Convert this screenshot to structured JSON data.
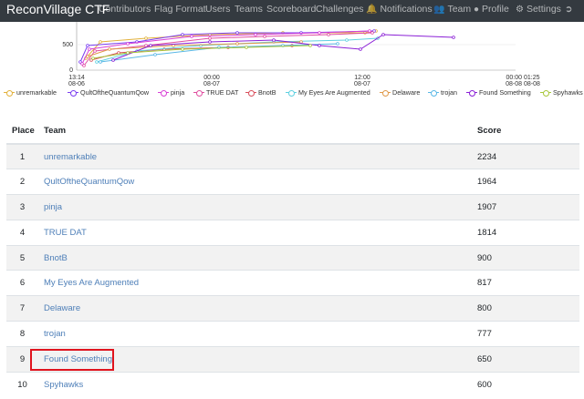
{
  "navbar": {
    "brand": "ReconVillage CTF",
    "links": [
      {
        "label": "Contributors",
        "icon": ""
      },
      {
        "label": "Flag Format",
        "icon": ""
      },
      {
        "label": "Users",
        "icon": ""
      },
      {
        "label": "Teams",
        "icon": ""
      },
      {
        "label": "Scoreboard",
        "icon": ""
      },
      {
        "label": "Challenges",
        "icon": ""
      },
      {
        "label": "Notifications",
        "icon": "bell-icon"
      },
      {
        "label": "Team",
        "icon": "users-icon"
      },
      {
        "label": "Profile",
        "icon": "user-circle-icon"
      },
      {
        "label": "Settings",
        "icon": "gear-icon"
      },
      {
        "label": "",
        "icon": "sign-out-icon"
      }
    ]
  },
  "chart_data": {
    "type": "line",
    "y_ticks": [
      "500",
      "0"
    ],
    "x_ticks": [
      {
        "time": "13:14",
        "date": "08-06"
      },
      {
        "time": "00:00",
        "date": "08-07"
      },
      {
        "time": "12:00",
        "date": "08-07"
      },
      {
        "time": "00:00 01:25",
        "date": "08-08 08-08"
      }
    ],
    "series": [
      {
        "name": "unremarkable",
        "color": "#e2b13c"
      },
      {
        "name": "QultOftheQuantumQow",
        "color": "#7a3df0"
      },
      {
        "name": "pinja",
        "color": "#d93fd6"
      },
      {
        "name": "TRUE DAT",
        "color": "#e04fa0"
      },
      {
        "name": "BnotB",
        "color": "#d94f5c"
      },
      {
        "name": "My Eyes Are Augmented",
        "color": "#5fd0e0"
      },
      {
        "name": "Delaware",
        "color": "#e09a4a"
      },
      {
        "name": "trojan",
        "color": "#5ab8e6"
      },
      {
        "name": "Found Something",
        "color": "#8a1fd6"
      },
      {
        "name": "Spyhawks",
        "color": "#a8c83a"
      }
    ]
  },
  "table": {
    "headers": {
      "place": "Place",
      "team": "Team",
      "score": "Score"
    },
    "rows": [
      {
        "place": "1",
        "team": "unremarkable",
        "score": "2234"
      },
      {
        "place": "2",
        "team": "QultOftheQuantumQow",
        "score": "1964"
      },
      {
        "place": "3",
        "team": "pinja",
        "score": "1907"
      },
      {
        "place": "4",
        "team": "TRUE DAT",
        "score": "1814"
      },
      {
        "place": "5",
        "team": "BnotB",
        "score": "900"
      },
      {
        "place": "6",
        "team": "My Eyes Are Augmented",
        "score": "817"
      },
      {
        "place": "7",
        "team": "Delaware",
        "score": "800"
      },
      {
        "place": "8",
        "team": "trojan",
        "score": "777"
      },
      {
        "place": "9",
        "team": "Found Something",
        "score": "650"
      },
      {
        "place": "10",
        "team": "Spyhawks",
        "score": "600"
      }
    ]
  }
}
